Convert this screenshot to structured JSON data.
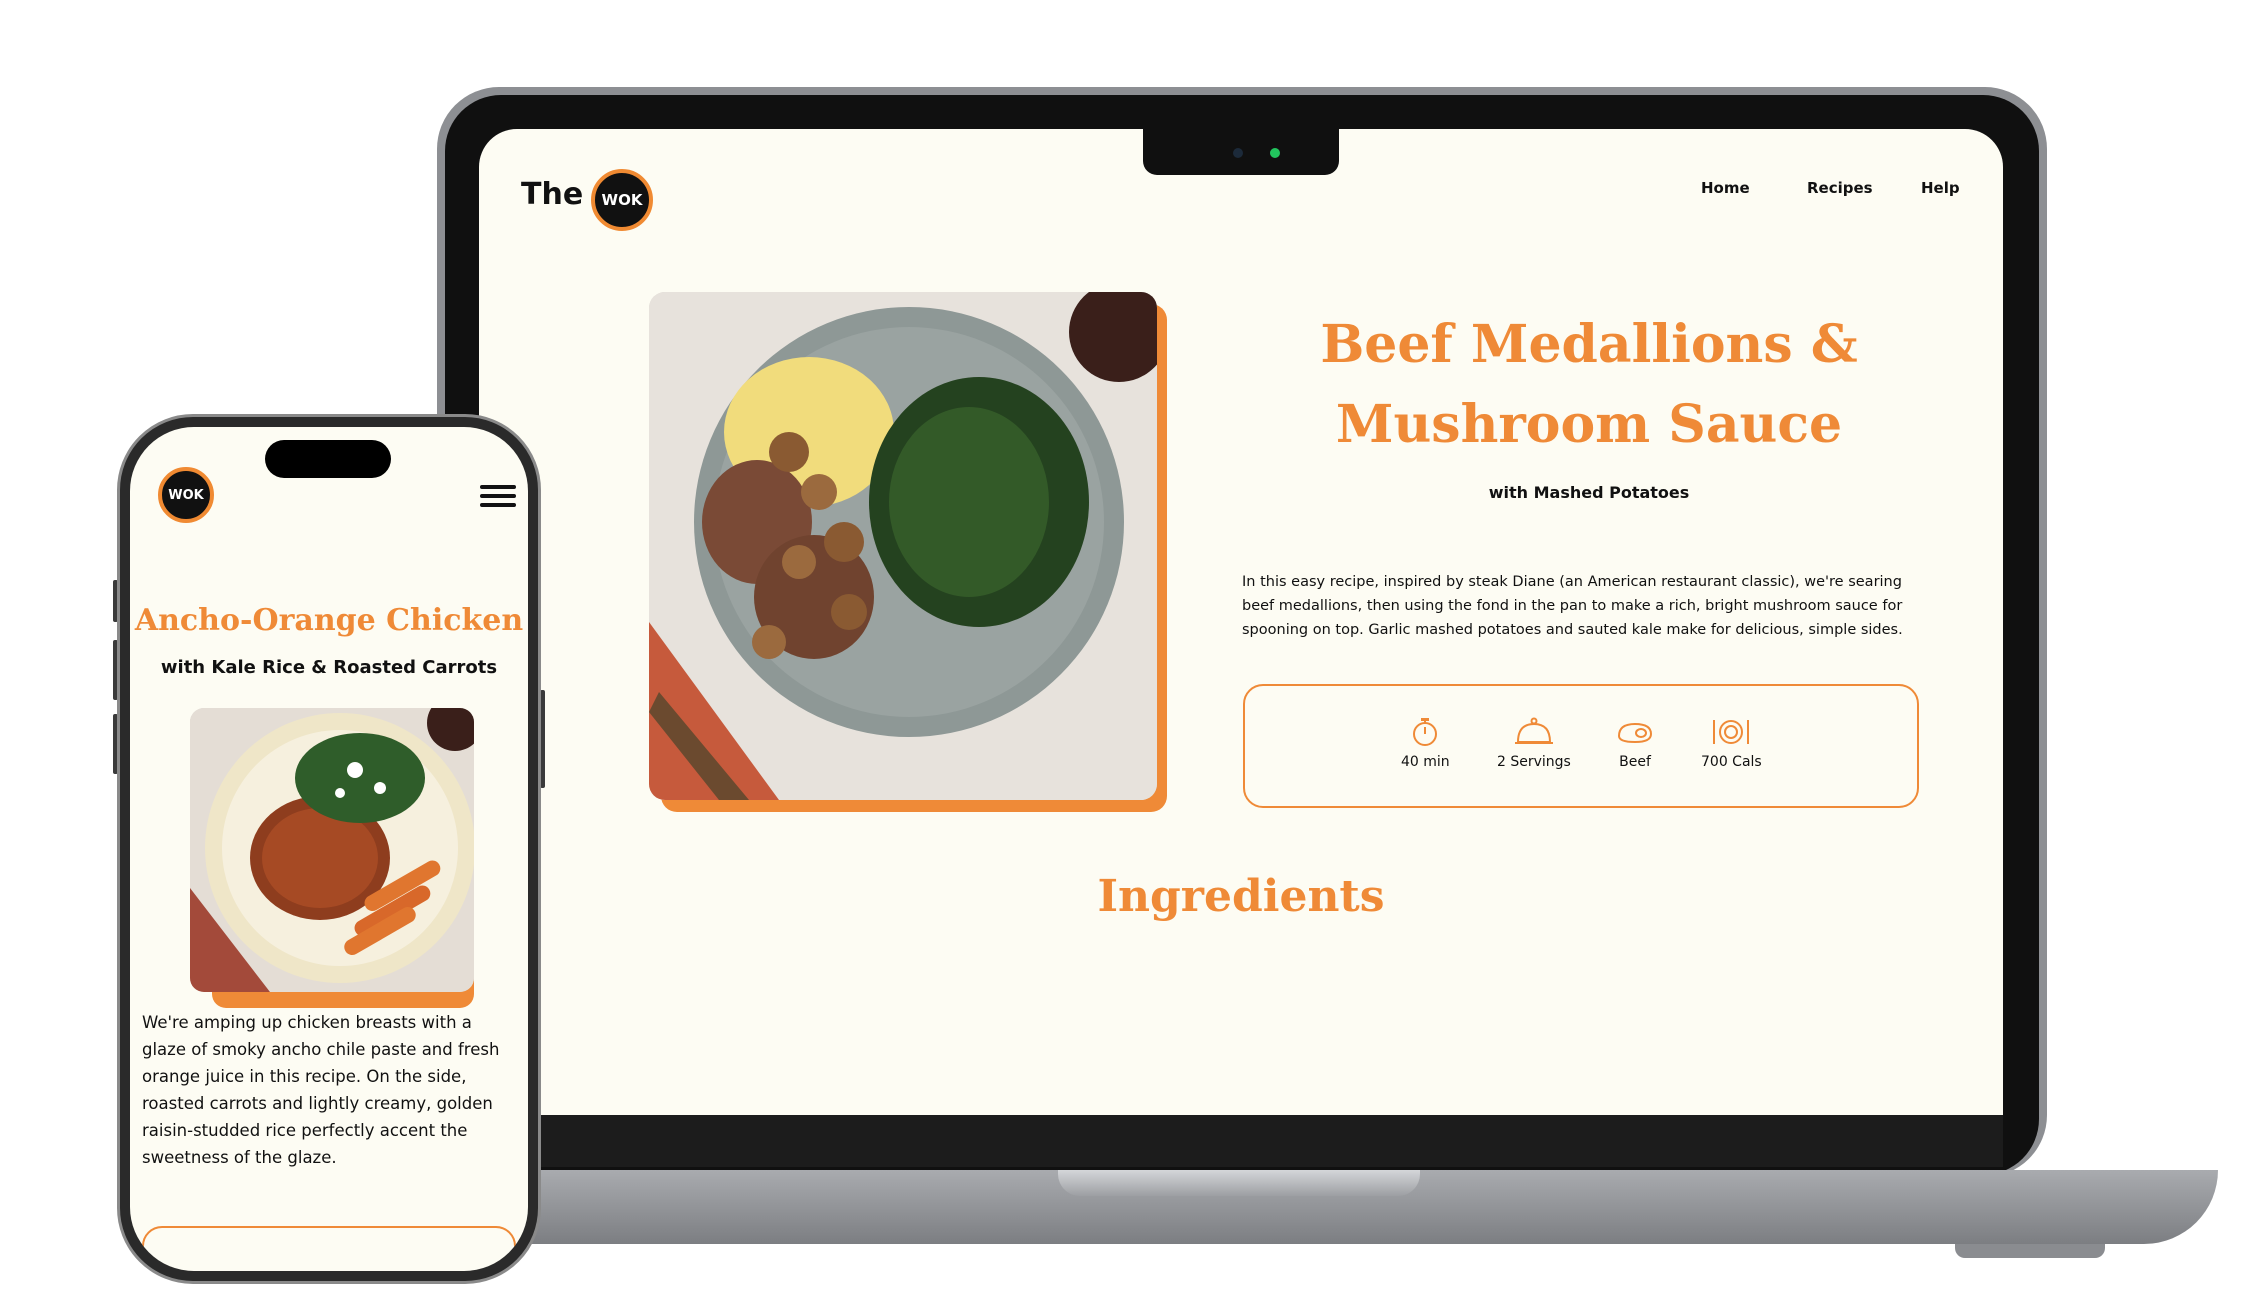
{
  "laptop": {
    "logo_text": "The",
    "logo_badge": "WOK",
    "nav": {
      "home": "Home",
      "recipes": "Recipes",
      "help": "Help"
    },
    "recipe": {
      "title_line1": "Beef Medallions &",
      "title_line2": "Mushroom Sauce",
      "subtitle": "with Mashed Potatoes",
      "description_line1": "In this easy recipe, inspired by steak Diane (an American restaurant classic), we're searing",
      "description_line2": "beef medallions, then using the fond in the pan to make a rich, bright mushroom sauce for",
      "description_line3": "spooning on top. Garlic mashed potatoes and sauted kale make for delicious, simple sides.",
      "info": {
        "time": "40 min",
        "servings": "2 Servings",
        "protein": "Beef",
        "calories": "700 Cals"
      },
      "section_heading": "Ingredients"
    }
  },
  "phone": {
    "logo_badge": "WOK",
    "recipe": {
      "title": "Ancho-Orange Chicken",
      "subtitle": "with Kale Rice & Roasted Carrots",
      "description_line1": "We're amping up chicken breasts with a",
      "description_line2": "glaze of smoky ancho chile paste and fresh",
      "description_line3": "orange juice in this recipe. On the side,",
      "description_line4": "roasted carrots and lightly creamy, golden",
      "description_line5": "raisin-studded rice perfectly accent the",
      "description_line6": "sweetness of the glaze."
    }
  },
  "colors": {
    "accent": "#ef8a37",
    "background": "#fdfcf3",
    "text": "#111111"
  },
  "icons": [
    "stopwatch-icon",
    "serving-cloche-icon",
    "steak-icon",
    "plate-cutlery-icon",
    "hamburger-menu-icon"
  ]
}
